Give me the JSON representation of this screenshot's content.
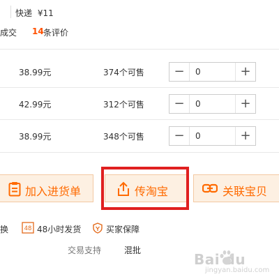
{
  "shipping": {
    "label": "快递",
    "price": "¥11"
  },
  "stats": {
    "deal_label": "成交",
    "review_count": "14",
    "review_label": "条评价"
  },
  "skus": [
    {
      "price": "38.99元",
      "stock": "374个可售",
      "qty": "0"
    },
    {
      "price": "42.99元",
      "stock": "312个可售",
      "qty": "0"
    },
    {
      "price": "38.99元",
      "stock": "348个可售",
      "qty": "0"
    }
  ],
  "stepper": {
    "minus": "−",
    "plus": "+"
  },
  "actions": {
    "add_to_list": "加入进货单",
    "upload_taobao": "传淘宝",
    "link_item": "关联宝贝"
  },
  "guarantees": {
    "exchange": "换",
    "ship48": "48小时发货",
    "buyer_protect": "买家保障"
  },
  "support": {
    "label": "交易支持",
    "value": "混批"
  },
  "watermark": {
    "brand": "Bai  du",
    "sub": "jingyan.baidu.com"
  },
  "colors": {
    "accent": "#ff6a00",
    "highlight": "#e02020",
    "button_bg": "#fdf0e2"
  }
}
